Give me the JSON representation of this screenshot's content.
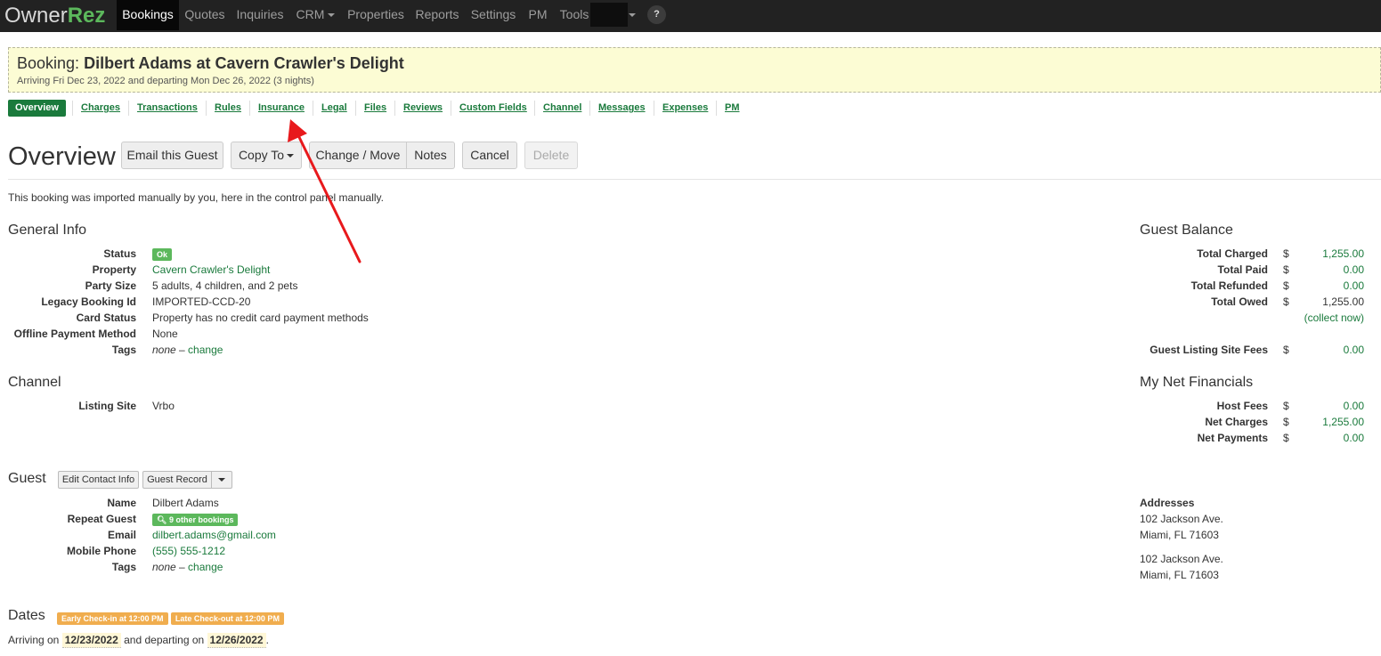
{
  "nav": {
    "logo_owner": "Owner",
    "logo_rez": "Rez",
    "items": [
      "Bookings",
      "Quotes",
      "Inquiries",
      "CRM",
      "Properties",
      "Reports",
      "Settings",
      "PM",
      "Tools"
    ],
    "help": "?"
  },
  "banner": {
    "title_prefix": "Booking:",
    "title_name": "Dilbert Adams at Cavern Crawler's Delight",
    "subtitle": "Arriving Fri Dec 23, 2022 and departing Mon Dec 26, 2022 (3 nights)"
  },
  "tabs": [
    "Overview",
    "Charges",
    "Transactions",
    "Rules",
    "Insurance",
    "Legal",
    "Files",
    "Reviews",
    "Custom Fields",
    "Channel",
    "Messages",
    "Expenses",
    "PM"
  ],
  "overview": {
    "title": "Overview",
    "buttons": {
      "email": "Email this Guest",
      "copy": "Copy To",
      "change": "Change / Move",
      "notes": "Notes",
      "cancel": "Cancel",
      "delete": "Delete"
    },
    "import_note": "This booking was imported manually by you, here in the control panel manually."
  },
  "general": {
    "heading": "General Info",
    "status_label": "Status",
    "status_value": "Ok",
    "property_label": "Property",
    "property_value": "Cavern Crawler's Delight",
    "party_label": "Party Size",
    "party_value": "5 adults, 4 children, and 2 pets",
    "legacy_label": "Legacy Booking Id",
    "legacy_value": "IMPORTED-CCD-20",
    "card_label": "Card Status",
    "card_value": "Property has no credit card payment methods",
    "offline_label": "Offline Payment Method",
    "offline_value": "None",
    "tags_label": "Tags",
    "tags_none": "none",
    "tags_sep": " – ",
    "tags_change": "change"
  },
  "channel": {
    "heading": "Channel",
    "listing_label": "Listing Site",
    "listing_value": "Vrbo"
  },
  "guest": {
    "heading": "Guest",
    "edit_contact": "Edit Contact Info",
    "guest_record": "Guest Record",
    "name_label": "Name",
    "name_value": "Dilbert Adams",
    "repeat_label": "Repeat Guest",
    "repeat_value": "9 other bookings",
    "email_label": "Email",
    "email_value": "dilbert.adams@gmail.com",
    "phone_label": "Mobile Phone",
    "phone_value": "(555) 555-1212",
    "tags_label": "Tags",
    "tags_none": "none",
    "tags_sep": " – ",
    "tags_change": "change"
  },
  "dates": {
    "heading": "Dates",
    "early_badge": "Early Check-in at 12:00 PM",
    "late_badge": "Late Check-out at 12:00 PM",
    "arriving_text": "Arriving on",
    "arrive_date": "12/23/2022",
    "departing_text": "and departing on",
    "depart_date": "12/26/2022",
    "period": "."
  },
  "balance": {
    "heading": "Guest Balance",
    "currency": "$",
    "total_charged_label": "Total Charged",
    "total_charged": "1,255.00",
    "total_paid_label": "Total Paid",
    "total_paid": "0.00",
    "total_refunded_label": "Total Refunded",
    "total_refunded": "0.00",
    "total_owed_label": "Total Owed",
    "total_owed": "1,255.00",
    "collect_now": "(collect now)",
    "guest_fees_label": "Guest Listing Site Fees",
    "guest_fees": "0.00"
  },
  "net": {
    "heading": "My Net Financials",
    "currency": "$",
    "host_fees_label": "Host Fees",
    "host_fees": "0.00",
    "net_charges_label": "Net Charges",
    "net_charges": "1,255.00",
    "net_payments_label": "Net Payments",
    "net_payments": "0.00"
  },
  "addresses": {
    "heading": "Addresses",
    "a1_line1": "102 Jackson Ave.",
    "a1_line2": "Miami, FL 71603",
    "a2_line1": "102 Jackson Ave.",
    "a2_line2": "Miami, FL 71603"
  },
  "colors": {
    "nav_bg": "#222222",
    "accent_green": "#1a7a3c",
    "badge_green": "#5cb85c",
    "badge_orange": "#f0ad4e",
    "banner_bg": "#fcfcd4",
    "annotation_arrow": "#e8191c"
  },
  "icons": {
    "search": "search-icon",
    "dropdown": "chevron-down-icon",
    "help": "help-icon",
    "annotation": "red-arrow-annotation"
  }
}
